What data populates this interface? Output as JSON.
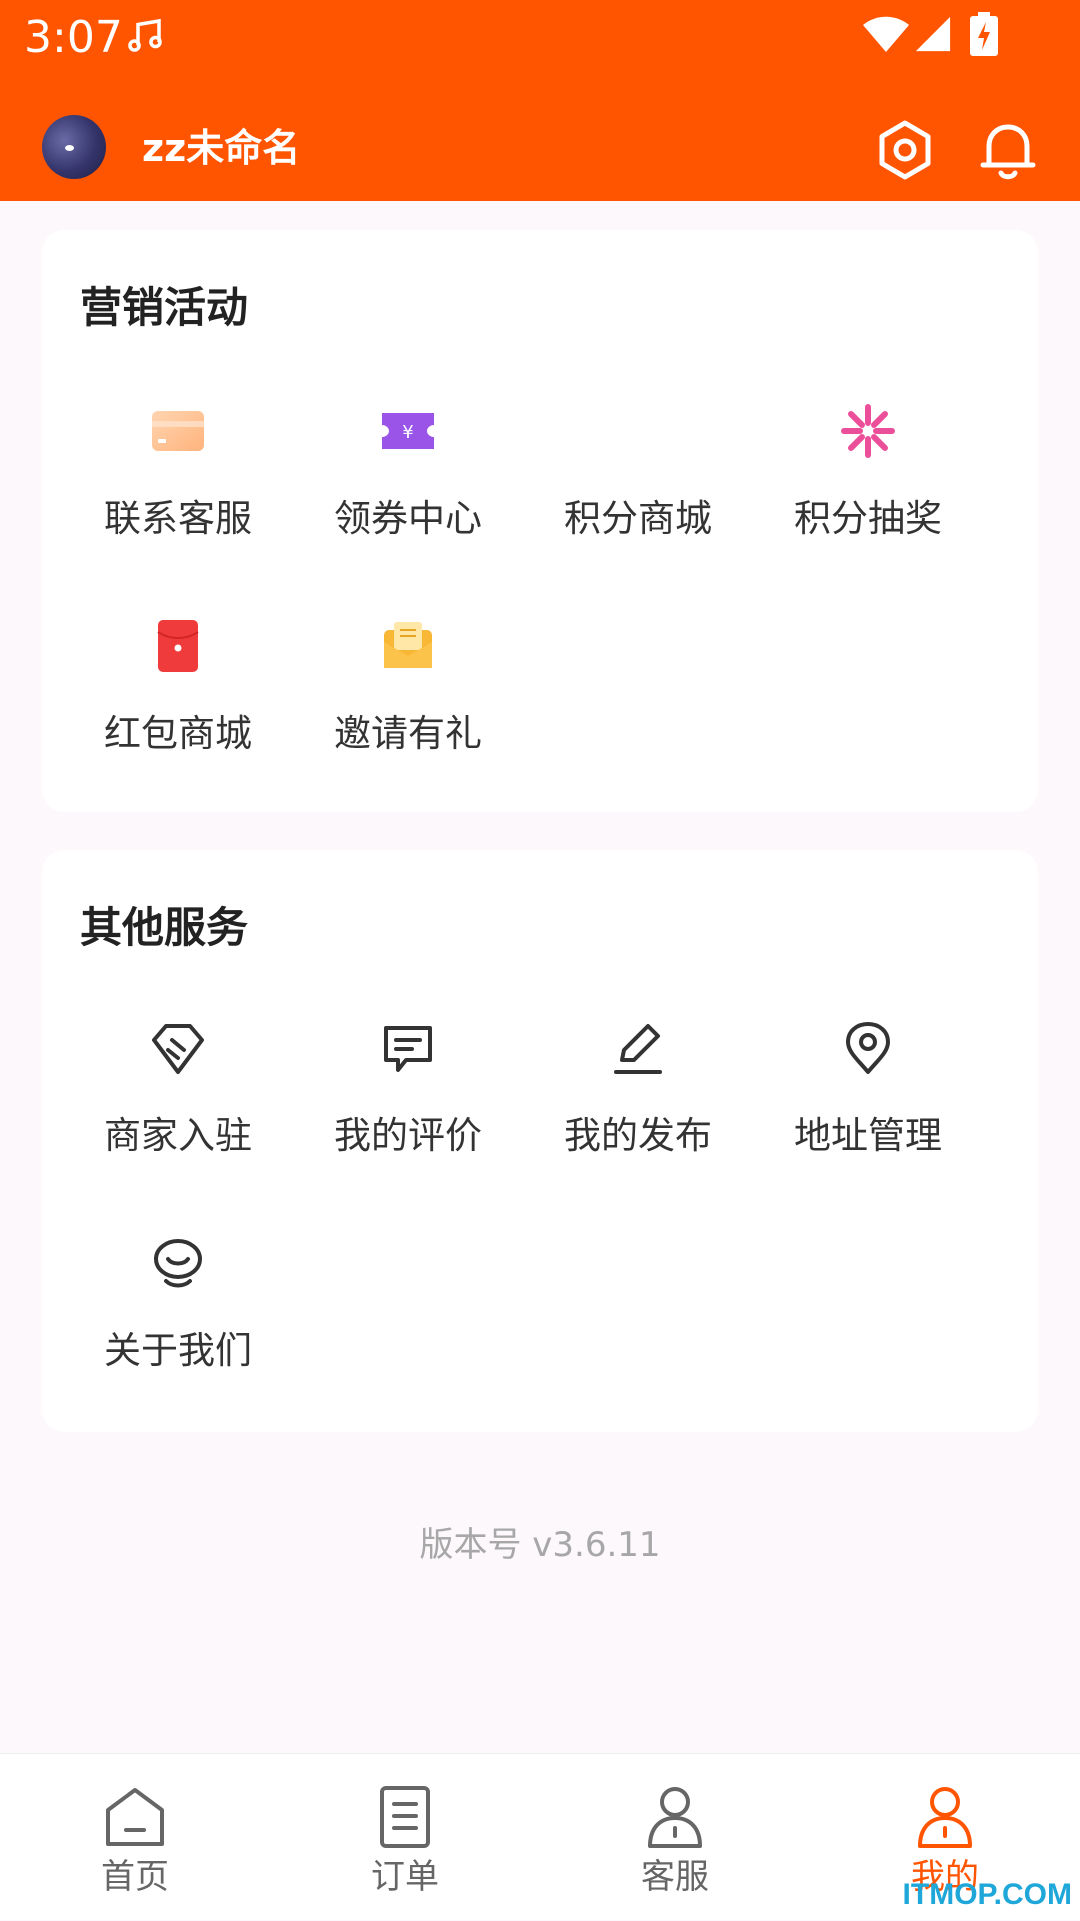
{
  "status_bar": {
    "time": "3:07"
  },
  "header": {
    "username": "zz未命名"
  },
  "marketing": {
    "title": "营销活动",
    "items": [
      {
        "label": "联系客服",
        "icon": "card-icon"
      },
      {
        "label": "领券中心",
        "icon": "coupon-icon"
      },
      {
        "label": "积分商城",
        "icon": "store-icon"
      },
      {
        "label": "积分抽奖",
        "icon": "pinwheel-icon"
      },
      {
        "label": "红包商城",
        "icon": "red-packet-icon"
      },
      {
        "label": "邀请有礼",
        "icon": "invite-envelope-icon"
      }
    ]
  },
  "services": {
    "title": "其他服务",
    "items": [
      {
        "label": "商家入驻",
        "icon": "merchant-icon"
      },
      {
        "label": "我的评价",
        "icon": "comment-icon"
      },
      {
        "label": "我的发布",
        "icon": "edit-icon"
      },
      {
        "label": "地址管理",
        "icon": "location-icon"
      },
      {
        "label": "关于我们",
        "icon": "about-icon"
      }
    ]
  },
  "version": "版本号 v3.6.11",
  "tabbar": {
    "tabs": [
      {
        "label": "首页",
        "icon": "home-icon"
      },
      {
        "label": "订单",
        "icon": "order-icon"
      },
      {
        "label": "客服",
        "icon": "customer-service-icon"
      },
      {
        "label": "我的",
        "icon": "profile-icon"
      }
    ],
    "active_index": 3
  },
  "watermark": "ITMOP.COM",
  "colors": {
    "brand": "#ff5400",
    "background": "#fcf8fb"
  }
}
